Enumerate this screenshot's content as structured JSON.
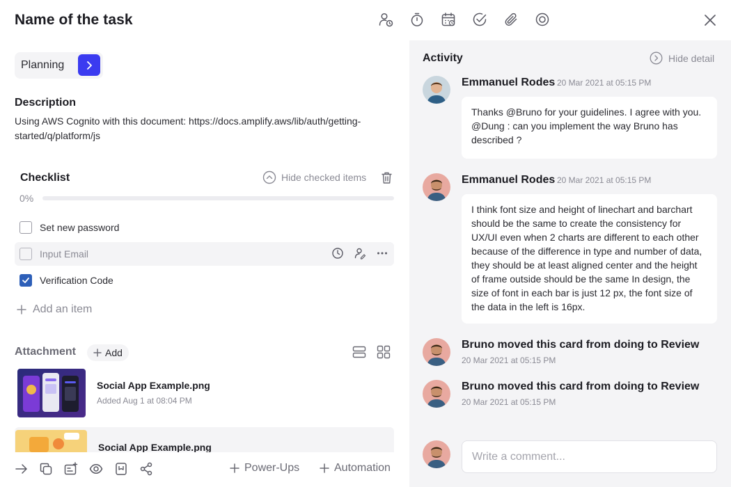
{
  "task": {
    "title": "Name of the task",
    "toolbar_icons": [
      "assign-user-icon",
      "timer-icon",
      "calendar-icon",
      "check-circle-icon",
      "paperclip-icon",
      "target-icon"
    ],
    "close_icon": "close-icon"
  },
  "status": {
    "label": "Planning",
    "accent": "#3b3bf0"
  },
  "description": {
    "heading": "Description",
    "text": "Using AWS Cognito with this document: https://docs.amplify.aws/lib/auth/getting-started/q/platform/js"
  },
  "checklist": {
    "heading": "Checklist",
    "hide_checked_label": "Hide checked items",
    "progress_label": "0%",
    "progress": 0,
    "items": [
      {
        "label": "Set new password",
        "checked": false
      },
      {
        "label": "Input Email",
        "checked": false
      },
      {
        "label": "Verification Code",
        "checked": true
      }
    ],
    "add_item_label": "Add an item"
  },
  "attachment": {
    "heading": "Attachment",
    "add_label": "Add",
    "files": [
      {
        "name": "Social App Example.png",
        "meta": "Added Aug 1 at 08:04 PM"
      },
      {
        "name": "Social App Example.png",
        "meta": ""
      }
    ]
  },
  "bottom_bar": {
    "icons": [
      "arrow-right-icon",
      "copy-icon",
      "card-add-icon",
      "eye-icon",
      "bookmark-icon",
      "share-icon"
    ],
    "power_ups_label": "Power-Ups",
    "automation_label": "Automation"
  },
  "activity": {
    "heading": "Activity",
    "hide_detail_label": "Hide detail",
    "comments": [
      {
        "author": "Emmanuel Rodes",
        "time": "20 Mar 2021 at 05:15 PM",
        "text": "Thanks @Bruno for your guidelines. I agree with you. @Dung : can you implement the way Bruno has described ?"
      },
      {
        "author": "Emmanuel Rodes",
        "time": "20 Mar 2021 at 05:15 PM",
        "text": "I think font size and height of linechart and barchart should be the same to create the consistency for UX/UI even when 2 charts are different to each other because of the difference in type and number of data, they should be at least aligned center and the height of frame outside should be the same In design, the size of font in each bar is just 12 px, the font size of the data in the left is 16px."
      }
    ],
    "logs": [
      {
        "text": "Bruno moved this card from doing to Review",
        "time": "20 Mar 2021 at 05:15 PM"
      },
      {
        "text": "Bruno moved this card from doing to Review",
        "time": "20 Mar 2021 at 05:15 PM"
      }
    ],
    "comment_placeholder": "Write a comment..."
  }
}
